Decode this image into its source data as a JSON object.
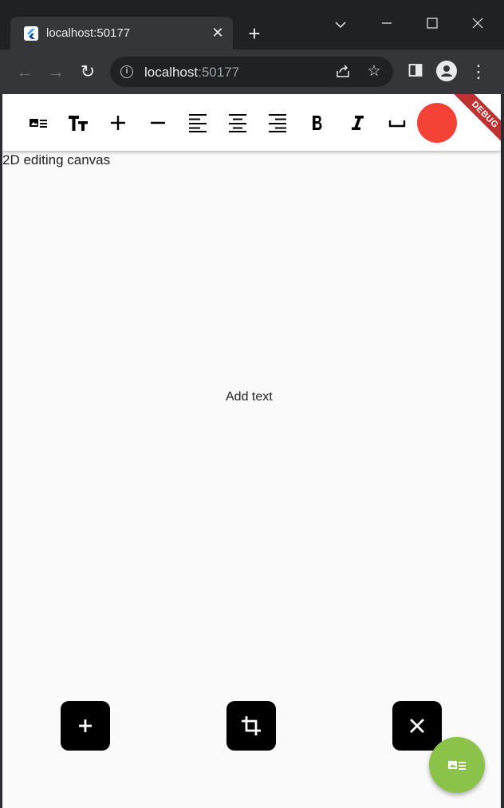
{
  "browser": {
    "tab": {
      "title": "localhost:50177"
    },
    "address": {
      "host": "localhost",
      "port": ":50177"
    }
  },
  "app": {
    "canvas_label": "2D editing canvas",
    "add_text_label": "Add text",
    "debug_banner": "DEBUG",
    "color_swatch": "#f44336",
    "fab_color": "#8bc34a",
    "toolbar_icons": [
      "image-text-icon",
      "text-size-icon",
      "plus-icon",
      "minus-icon",
      "align-left-icon",
      "align-center-icon",
      "align-right-icon",
      "bold-icon",
      "italic-icon",
      "space-icon",
      "color-picker"
    ]
  }
}
